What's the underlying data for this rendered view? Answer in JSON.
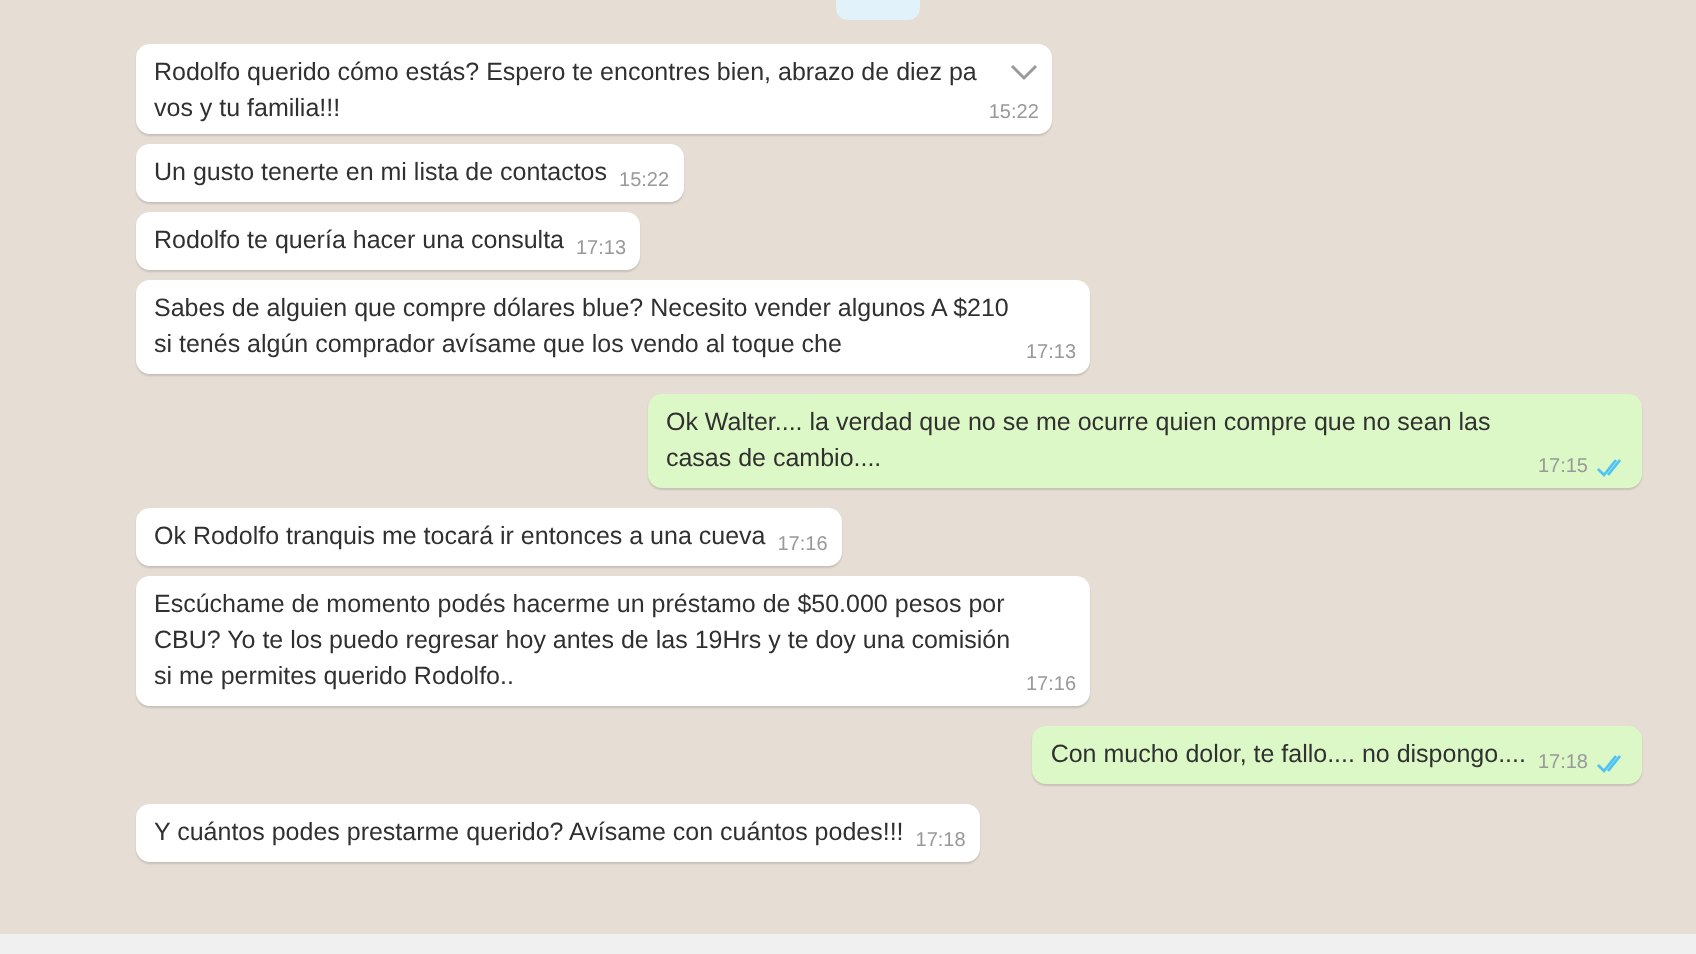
{
  "messages": [
    {
      "kind": "incoming",
      "text": "Rodolfo querido cómo estás? Espero te encontres bien, abrazo de diez pa",
      "text_2": "vos y tu familia!!!",
      "time": "15:22",
      "hovered": true
    },
    {
      "kind": "incoming",
      "text": "Un gusto tenerte en mi lista de contactos",
      "time": "15:22",
      "hovered": false
    },
    {
      "kind": "incoming",
      "text": "Rodolfo te quería hacer  una consulta",
      "time": "17:13",
      "hovered": false
    },
    {
      "kind": "incoming",
      "text": "Sabes de alguien que compre dólares blue? Necesito vender algunos A $210 si tenés algún comprador avísame que los vendo al toque che",
      "time": "17:13",
      "hovered": false
    },
    {
      "kind": "outgoing",
      "text": "Ok Walter.... la verdad que no se me ocurre quien compre que no sean las casas de cambio....",
      "time": "17:15",
      "read": true,
      "hovered": false
    },
    {
      "kind": "incoming",
      "text": "Ok Rodolfo tranquis me tocará ir entonces a una cueva",
      "time": "17:16",
      "hovered": false
    },
    {
      "kind": "incoming",
      "text": "Escúchame de momento podés hacerme un préstamo de $50.000 pesos por CBU? Yo te los puedo regresar hoy antes de las 19Hrs y te doy una comisión si me permites querido Rodolfo..",
      "time": "17:16",
      "hovered": false
    },
    {
      "kind": "outgoing",
      "text": "Con mucho dolor, te fallo.... no dispongo....",
      "time": "17:18",
      "read": true,
      "hovered": false
    },
    {
      "kind": "incoming",
      "text": "Y cuántos podes prestarme querido? Avísame con cuántos podes!!!",
      "time": "17:18",
      "hovered": false
    }
  ]
}
